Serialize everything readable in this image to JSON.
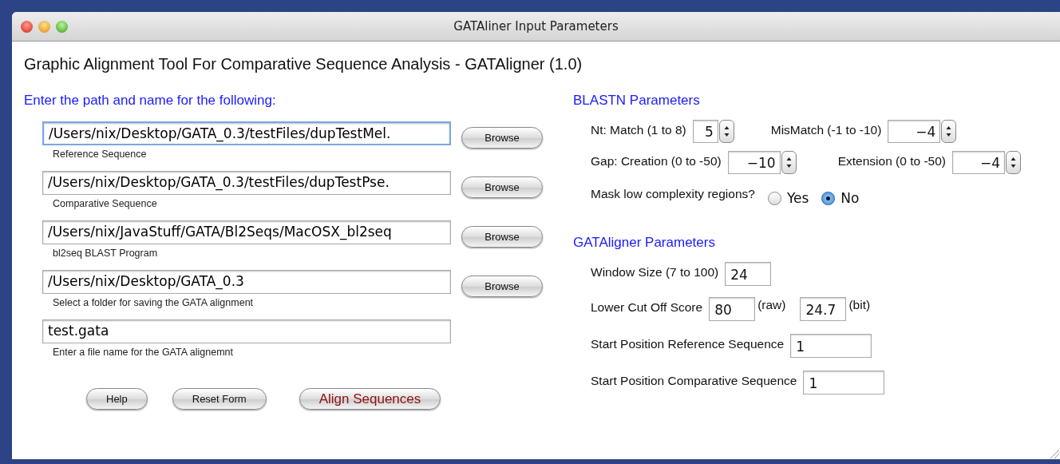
{
  "window": {
    "title": "GATAliner Input Parameters"
  },
  "heading": "Graphic Alignment Tool For Comparative Sequence Analysis - GATAligner (1.0)",
  "files": {
    "title": "Enter the path and name for the following:",
    "fields": [
      {
        "value": "/Users/nix/Desktop/GATA_0.3/testFiles/dupTestMel.",
        "caption": "Reference Sequence",
        "button": "Browse",
        "focused": true
      },
      {
        "value": "/Users/nix/Desktop/GATA_0.3/testFiles/dupTestPse.",
        "caption": "Comparative Sequence",
        "button": "Browse",
        "focused": false
      },
      {
        "value": "/Users/nix/JavaStuff/GATA/Bl2Seqs/MacOSX_bl2seq",
        "caption": "bl2seq BLAST Program",
        "button": "Browse",
        "focused": false
      },
      {
        "value": "/Users/nix/Desktop/GATA_0.3",
        "caption": "Select a folder for saving the GATA alignment",
        "button": "Browse",
        "focused": false
      },
      {
        "value": "test.gata",
        "caption": "Enter a file name for the GATA alignemnt",
        "focused": false
      }
    ]
  },
  "buttons": [
    {
      "label": "Help",
      "kind": "normal"
    },
    {
      "label": "Reset Form",
      "kind": "normal"
    },
    {
      "label": "Align Sequences",
      "kind": "primary"
    }
  ],
  "blastn": {
    "title": "BLASTN Parameters",
    "rows": [
      [
        {
          "label": "Nt:  Match (1 to 8)",
          "value": "5"
        },
        {
          "label": "MisMatch (-1 to -10)",
          "value": "−4"
        }
      ],
      [
        {
          "label": "Gap:  Creation (0 to -50)",
          "value": "−10"
        },
        {
          "label": "Extension (0 to -50)",
          "value": "−4"
        }
      ]
    ],
    "mask": {
      "label": "Mask low complexity regions?",
      "options": [
        {
          "label": "Yes",
          "selected": false
        },
        {
          "label": "No",
          "selected": true
        }
      ]
    }
  },
  "gataligner": {
    "title": "GATAligner Parameters",
    "window_size": {
      "label": "Window Size (7 to 100)",
      "value": "24"
    },
    "cutoff": {
      "label": "Lower Cut Off Score",
      "raw": "80",
      "raw_unit": "(raw)",
      "bit": "24.7",
      "bit_unit": "(bit)"
    },
    "starts": [
      {
        "label": "Start Position Reference Sequence",
        "value": "1"
      },
      {
        "label": "Start Position Comparative Sequence",
        "value": "1"
      }
    ]
  }
}
